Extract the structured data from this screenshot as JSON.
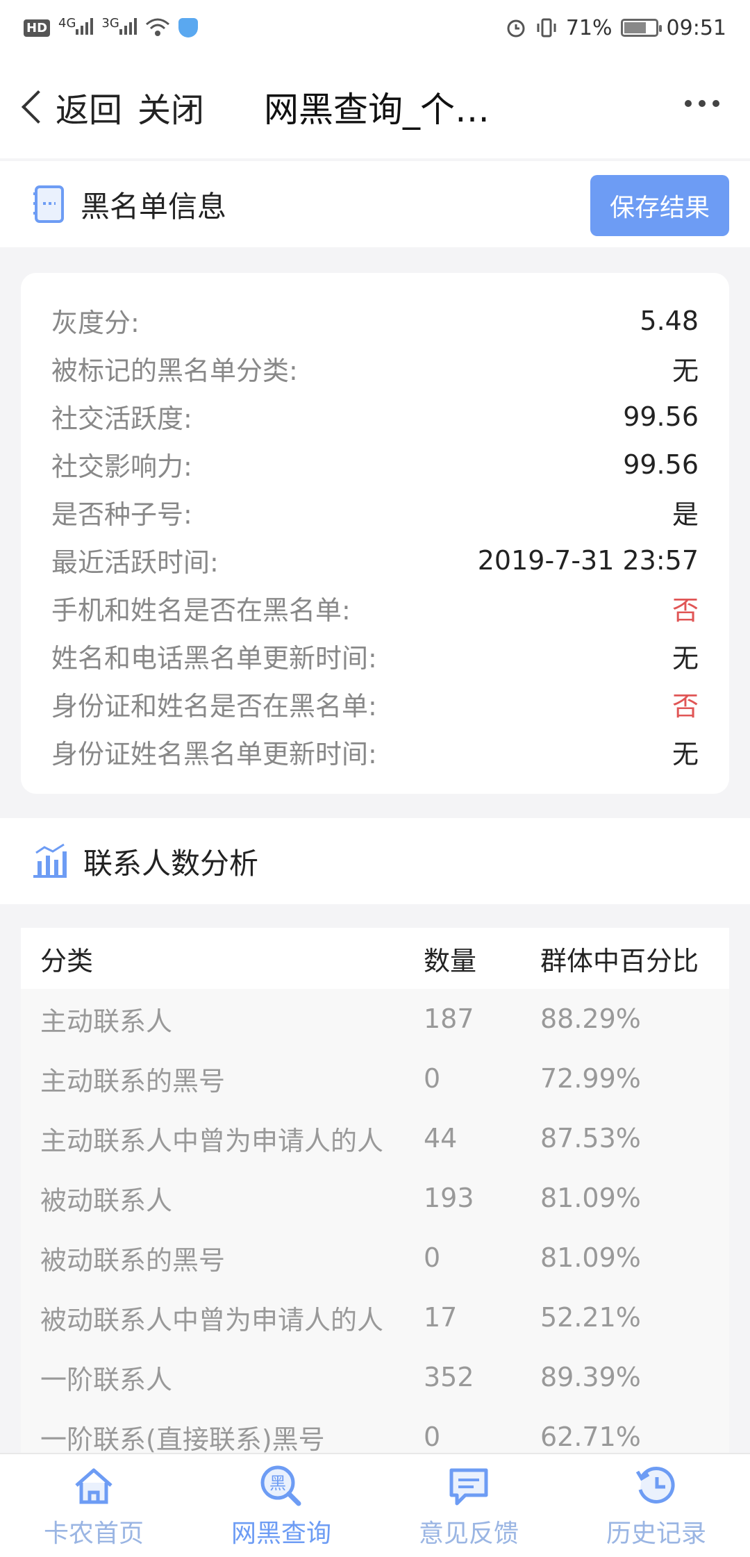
{
  "status_bar": {
    "hd": "HD",
    "net1": "4G",
    "net2": "3G",
    "battery_text": "71%",
    "battery_level": 0.71,
    "time": "09:51"
  },
  "nav": {
    "back_label": "返回",
    "close_label": "关闭",
    "title": "网黑查询_个…"
  },
  "blacklist": {
    "title": "黑名单信息",
    "save_label": "保存结果",
    "items": [
      {
        "label": "灰度分:",
        "value": "5.48"
      },
      {
        "label": "被标记的黑名单分类:",
        "value": "无"
      },
      {
        "label": "社交活跃度:",
        "value": "99.56"
      },
      {
        "label": "社交影响力:",
        "value": "99.56"
      },
      {
        "label": "是否种子号:",
        "value": "是"
      },
      {
        "label": "最近活跃时间:",
        "value": "2019-7-31 23:57"
      },
      {
        "label": "手机和姓名是否在黑名单:",
        "value": "否"
      },
      {
        "label": "姓名和电话黑名单更新时间:",
        "value": "无"
      },
      {
        "label": "身份证和姓名是否在黑名单:",
        "value": "否"
      },
      {
        "label": "身份证姓名黑名单更新时间:",
        "value": "无"
      }
    ],
    "alert_color": "#e05555"
  },
  "contacts": {
    "title": "联系人数分析",
    "headers": [
      "分类",
      "数量",
      "群体中百分比"
    ],
    "rows": [
      [
        "主动联系人",
        "187",
        "88.29%"
      ],
      [
        "主动联系的黑号",
        "0",
        "72.99%"
      ],
      [
        "主动联系人中曾为申请人的人",
        "44",
        "87.53%"
      ],
      [
        "被动联系人",
        "193",
        "81.09%"
      ],
      [
        "被动联系的黑号",
        "0",
        "81.09%"
      ],
      [
        "被动联系人中曾为申请人的人",
        "17",
        "52.21%"
      ],
      [
        "一阶联系人",
        "352",
        "89.39%"
      ],
      [
        "一阶联系(直接联系)黑号",
        "0",
        "62.71%"
      ]
    ]
  },
  "tabbar": {
    "items": [
      {
        "label": "卡农首页",
        "icon": "home-icon"
      },
      {
        "label": "网黑查询",
        "icon": "blacklist-search-icon",
        "glyph": "黑"
      },
      {
        "label": "意见反馈",
        "icon": "feedback-icon"
      },
      {
        "label": "历史记录",
        "icon": "history-icon"
      }
    ],
    "accent": "#6d9cf4"
  }
}
